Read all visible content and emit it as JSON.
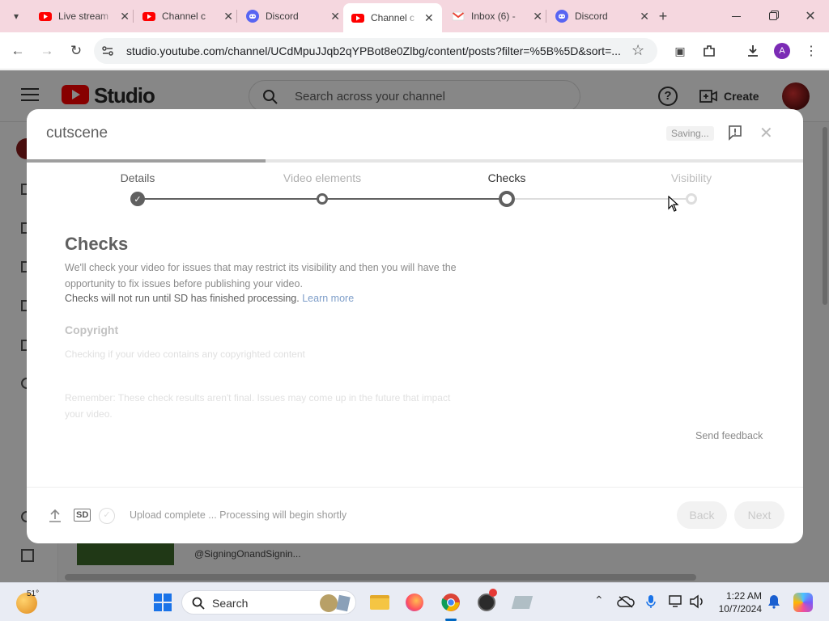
{
  "browser": {
    "tabs": [
      {
        "title": "Live stream",
        "favicon": "youtube-icon"
      },
      {
        "title": "Channel c",
        "favicon": "youtube-icon"
      },
      {
        "title": "Discord",
        "favicon": "discord-icon"
      },
      {
        "title": "Channel c",
        "favicon": "youtube-icon",
        "active": true
      },
      {
        "title": "Inbox (6) -",
        "favicon": "gmail-icon"
      },
      {
        "title": "Discord",
        "favicon": "discord-icon"
      }
    ],
    "url": "studio.youtube.com/channel/UCdMpuJJqb2qYPBot8e0Zlbg/content/posts?filter=%5B%5D&sort=...",
    "profile_initial": "A"
  },
  "studio": {
    "logo_text": "Studio",
    "search_placeholder": "Search across your channel",
    "create_label": "Create",
    "bg_channel_text": "@SigningOnandSignin..."
  },
  "dialog": {
    "title": "cutscene",
    "saving_label": "Saving...",
    "steps": [
      "Details",
      "Video elements",
      "Checks",
      "Visibility"
    ],
    "heading": "Checks",
    "description": "We'll check your video for issues that may restrict its visibility and then you will have the opportunity to fix issues before publishing your video.",
    "processing_note": "Checks will not run until SD has finished processing.",
    "learn_more": "Learn more",
    "copyright_title": "Copyright",
    "copyright_desc": "Checking if your video contains any copyrighted content",
    "remember_text": "Remember: These check results aren't final. Issues may come up in the future that impact your video.",
    "send_feedback": "Send feedback",
    "sd_badge": "SD",
    "status_text": "Upload complete ... Processing will begin shortly",
    "back_label": "Back",
    "next_label": "Next"
  },
  "taskbar": {
    "weather_temp": "51°",
    "search_label": "Search",
    "time": "1:22 AM",
    "date": "10/7/2024"
  },
  "colors": {
    "accent": "#065fd4",
    "youtube_red": "#ff0000",
    "tab_strip": "#f5d7df"
  }
}
